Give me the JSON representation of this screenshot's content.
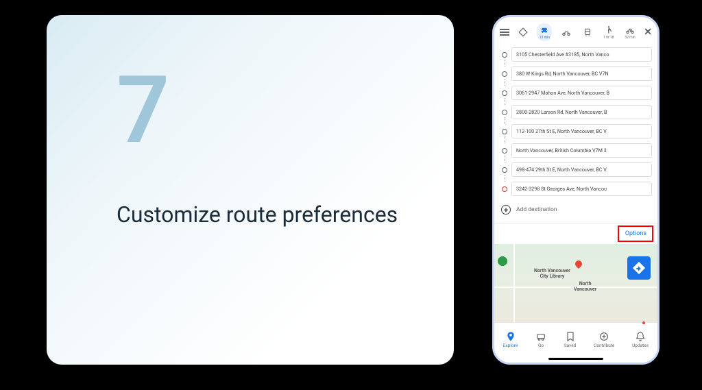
{
  "instruction": {
    "step_number": "7",
    "title": "Customize route preferences"
  },
  "phone": {
    "modes": {
      "car_time": "13 min",
      "walk_time": "1 hr 18",
      "bike_time": "32 min"
    },
    "waypoints": [
      "3105 Chesterfield Ave #3185, North Vanco",
      "380 W Kings Rd, North Vancouver, BC V7N",
      "3061-2947 Mahon Ave, North Vancouver, B",
      "2800-2820 Larson Rd, North Vancouver, B",
      "112-100 27th St E, North Vancouver, BC V",
      "North Vancouver, British Columbia V7M 3",
      "498-474 29th St E, North Vancouver, BC V",
      "3242-3298 St Georges Ave, North Vancou"
    ],
    "add_destination_label": "Add destination",
    "options_label": "Options",
    "map_labels": {
      "library": "North Vancouver\nCity Library",
      "city": "North\nVancouver"
    },
    "bottom_nav": {
      "explore": "Explore",
      "go": "Go",
      "saved": "Saved",
      "contribute": "Contribute",
      "updates": "Updates"
    }
  }
}
